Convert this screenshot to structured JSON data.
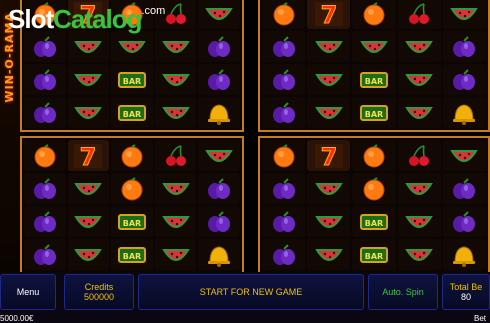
{
  "watermark": {
    "slot": "Slot",
    "catalog": "Catalog",
    "com": ".com"
  },
  "side_logo": "WIN-O-RAMA",
  "reels": {
    "g1": [
      "orange",
      "seven",
      "orange",
      "cherry",
      "watermelon",
      "plum",
      "watermelon",
      "watermelon",
      "watermelon",
      "plum",
      "plum",
      "watermelon",
      "bar",
      "watermelon",
      "plum",
      "plum",
      "watermelon",
      "bar",
      "watermelon",
      "bell"
    ],
    "g2": [
      "orange",
      "seven",
      "orange",
      "cherry",
      "watermelon",
      "plum",
      "watermelon",
      "watermelon",
      "watermelon",
      "plum",
      "plum",
      "watermelon",
      "bar",
      "watermelon",
      "plum",
      "plum",
      "watermelon",
      "bar",
      "watermelon",
      "bell"
    ],
    "g3": [
      "orange",
      "seven",
      "orange",
      "cherry",
      "watermelon",
      "plum",
      "watermelon",
      "orange",
      "watermelon",
      "plum",
      "plum",
      "watermelon",
      "bar",
      "watermelon",
      "plum",
      "plum",
      "watermelon",
      "bar",
      "watermelon",
      "bell"
    ],
    "g4": [
      "orange",
      "seven",
      "orange",
      "cherry",
      "watermelon",
      "plum",
      "watermelon",
      "orange",
      "watermelon",
      "plum",
      "plum",
      "watermelon",
      "bar",
      "watermelon",
      "plum",
      "plum",
      "watermelon",
      "bar",
      "watermelon",
      "bell"
    ]
  },
  "bar_text": "BAR",
  "bottom": {
    "menu": "Menu",
    "credits_label": "Credits",
    "credits_value": "500000",
    "start": "START FOR NEW GAME",
    "auto_spin": "Auto. Spin",
    "total_bet_label": "Total Be",
    "total_bet_value": "80",
    "balance": "5000.00€",
    "bet_label_trunc": "Bet"
  },
  "colors": {
    "frame": "#c97a1e",
    "gold": "#f0c000",
    "green": "#3ec83a",
    "button_bg": "#0f1340"
  }
}
